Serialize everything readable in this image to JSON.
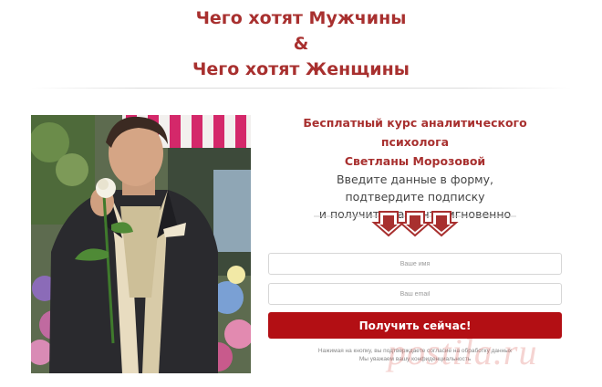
{
  "header": {
    "line1": "Чего хотят Мужчины",
    "ampersand": "&",
    "line2": "Чего хотят Женщины"
  },
  "offer": {
    "title_line1": "Бесплатный курс аналитического психолога",
    "title_line2": "Светланы Морозовой",
    "instr_line1": "Введите данные в форму,",
    "instr_line2": "подтвердите подписку",
    "instr_line3": "и получите на почту мгновенно"
  },
  "form": {
    "name_placeholder": "Ваше имя",
    "email_placeholder": "Ваш email",
    "submit_label": "Получить сейчас!",
    "note_line1": "Нажимая на кнопку, вы подтверждаете согласие на обработку данных",
    "note_line2": "Мы уважаем вашу конфиденциальность"
  },
  "watermark": "postila.ru",
  "colors": {
    "accent": "#a8302f",
    "button": "#b30f14"
  }
}
